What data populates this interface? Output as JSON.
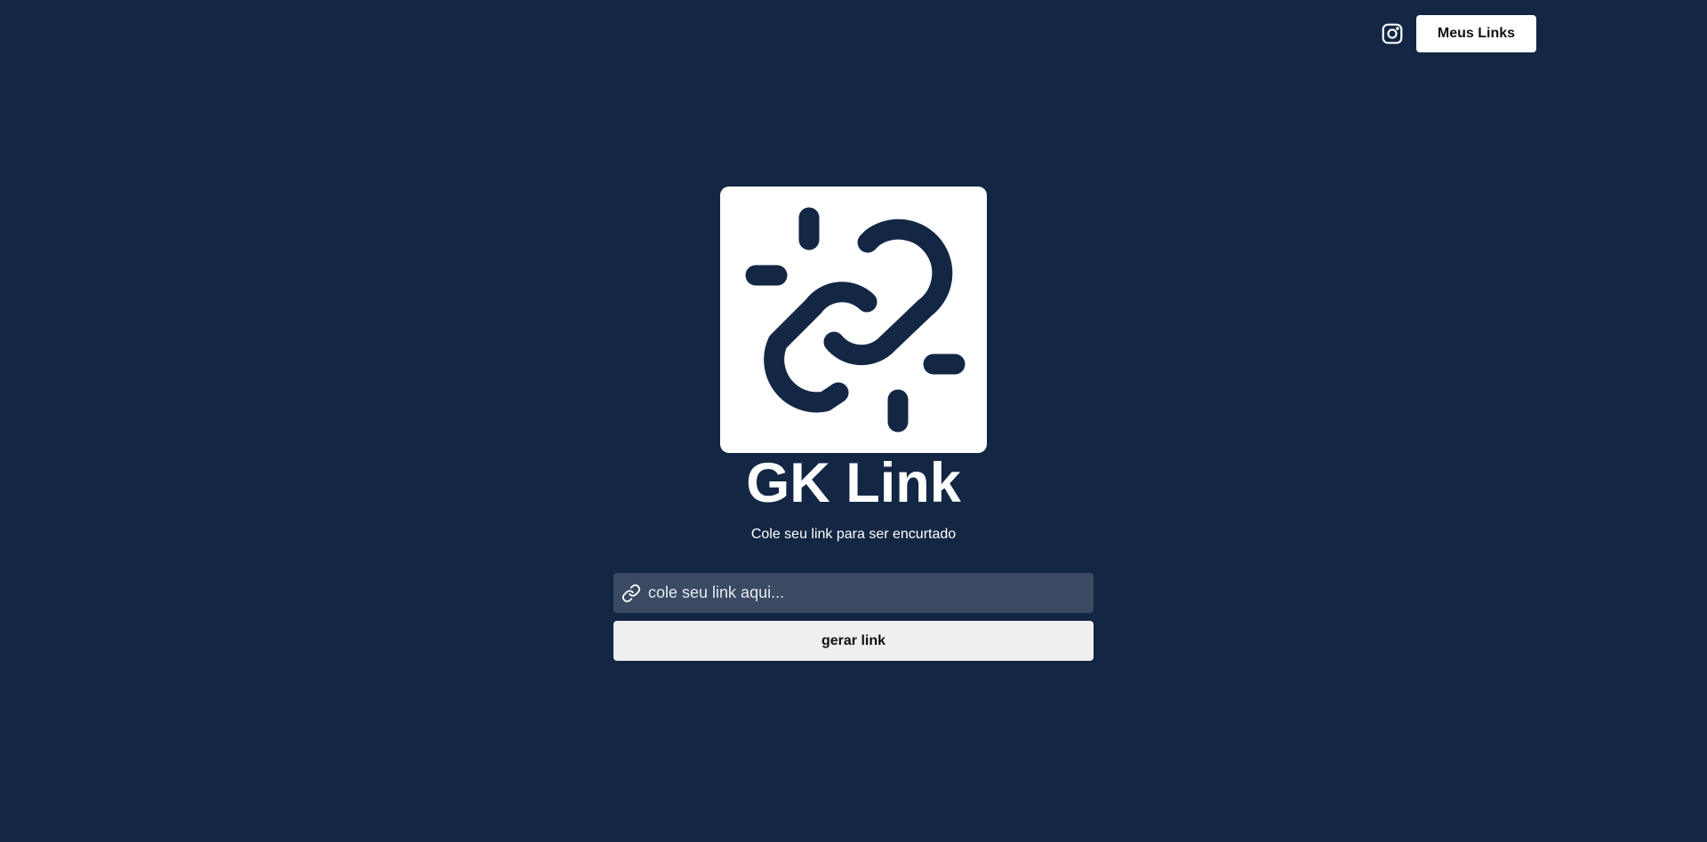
{
  "colors": {
    "background": "#132744",
    "input_background": "#3a4a63",
    "button_background": "#efefef",
    "logo_background": "#ffffff"
  },
  "header": {
    "instagram_icon": "instagram-icon",
    "my_links_label": "Meus Links"
  },
  "hero": {
    "logo_icon": "broken-chain-link-icon",
    "title": "GK Link",
    "subtitle": "Cole seu link para ser encurtado"
  },
  "form": {
    "input_icon": "link-icon",
    "input_placeholder": "cole seu link aqui...",
    "input_value": "",
    "submit_label": "gerar link"
  }
}
